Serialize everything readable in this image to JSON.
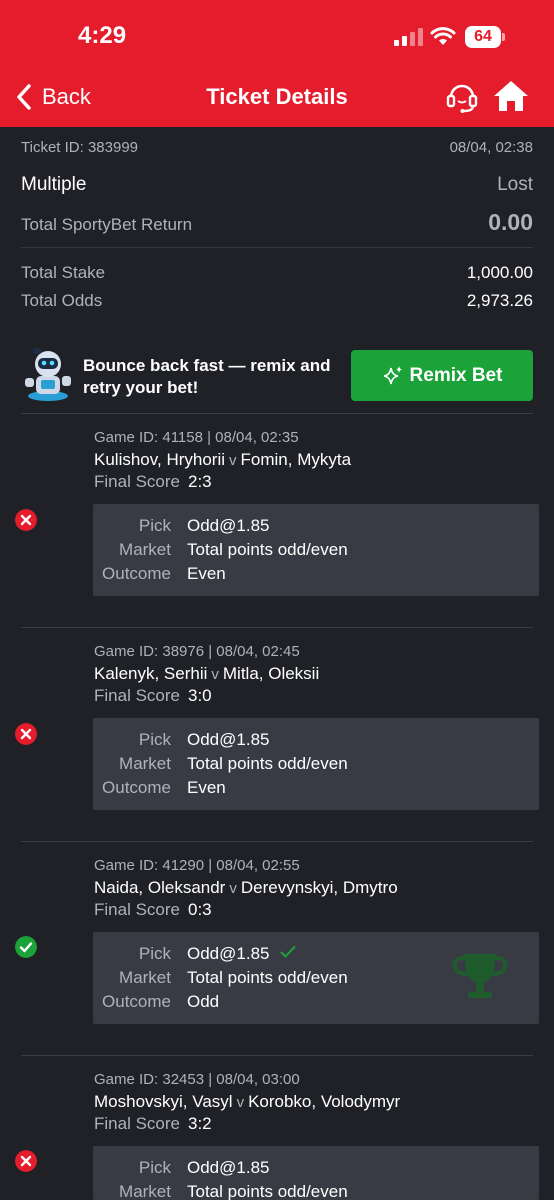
{
  "status_bar": {
    "time": "4:29",
    "battery": "64"
  },
  "header": {
    "back_label": "Back",
    "title": "Ticket Details"
  },
  "summary": {
    "ticket_id": "Ticket ID: 383999",
    "datetime": "08/04, 02:38",
    "bet_type": "Multiple",
    "result": "Lost",
    "return_label": "Total SportyBet Return",
    "return_value": "0.00",
    "stake_label": "Total Stake",
    "stake_value": "1,000.00",
    "odds_label": "Total Odds",
    "odds_value": "2,973.26"
  },
  "promo": {
    "text": "Bounce back fast — remix and retry your bet!",
    "button_label": "Remix Bet"
  },
  "labels": {
    "final_score": "Final Score",
    "pick": "Pick",
    "market": "Market",
    "outcome": "Outcome",
    "versus": "v"
  },
  "colors": {
    "brand_red": "#e41c2c",
    "won_green": "#1ba33a",
    "lost_red": "#e41c2c"
  },
  "games": [
    {
      "game_id": "Game ID: 41158 | 08/04, 02:35",
      "home": "Kulishov, Hryhorii",
      "away": "Fomin, Mykyta",
      "score": "2:3",
      "pick": "Odd@1.85",
      "market": "Total points odd/even",
      "outcome": "Even",
      "status": "lost"
    },
    {
      "game_id": "Game ID: 38976 | 08/04, 02:45",
      "home": "Kalenyk, Serhii",
      "away": "Mitla, Oleksii",
      "score": "3:0",
      "pick": "Odd@1.85",
      "market": "Total points odd/even",
      "outcome": "Even",
      "status": "lost"
    },
    {
      "game_id": "Game ID: 41290 | 08/04, 02:55",
      "home": "Naida, Oleksandr",
      "away": "Derevynskyi, Dmytro",
      "score": "0:3",
      "pick": "Odd@1.85",
      "market": "Total points odd/even",
      "outcome": "Odd",
      "status": "won"
    },
    {
      "game_id": "Game ID: 32453 | 08/04, 03:00",
      "home": "Moshovskyi, Vasyl",
      "away": "Korobko, Volodymyr",
      "score": "3:2",
      "pick": "Odd@1.85",
      "market": "Total points odd/even",
      "outcome": "",
      "status": "lost"
    }
  ]
}
